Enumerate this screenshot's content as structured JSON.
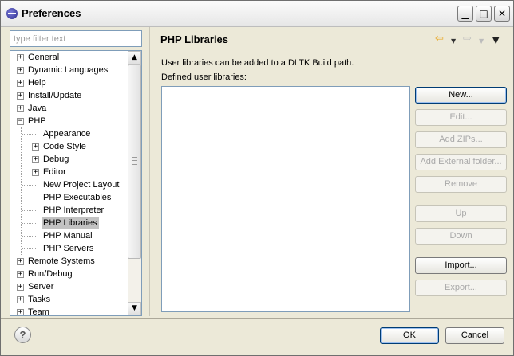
{
  "window": {
    "title": "Preferences"
  },
  "filter": {
    "placeholder": "type filter text"
  },
  "tree": {
    "items": [
      {
        "label": "General",
        "expander": "+"
      },
      {
        "label": "Dynamic Languages",
        "expander": "+"
      },
      {
        "label": "Help",
        "expander": "+"
      },
      {
        "label": "Install/Update",
        "expander": "+"
      },
      {
        "label": "Java",
        "expander": "+"
      },
      {
        "label": "PHP",
        "expander": "−"
      },
      {
        "label": "Appearance"
      },
      {
        "label": "Code Style",
        "expander": "+"
      },
      {
        "label": "Debug",
        "expander": "+"
      },
      {
        "label": "Editor",
        "expander": "+"
      },
      {
        "label": "New Project Layout"
      },
      {
        "label": "PHP Executables"
      },
      {
        "label": "PHP Interpreter"
      },
      {
        "label": "PHP Libraries",
        "selected": true
      },
      {
        "label": "PHP Manual"
      },
      {
        "label": "PHP Servers"
      },
      {
        "label": "Remote Systems",
        "expander": "+"
      },
      {
        "label": "Run/Debug",
        "expander": "+"
      },
      {
        "label": "Server",
        "expander": "+"
      },
      {
        "label": "Tasks",
        "expander": "+"
      },
      {
        "label": "Team",
        "expander": "+"
      }
    ]
  },
  "page": {
    "title": "PHP Libraries",
    "description": "User libraries can be added to a DLTK Build path.",
    "list_label": "Defined user libraries:"
  },
  "buttons": {
    "new": "New...",
    "edit": "Edit...",
    "add_zips": "Add ZIPs...",
    "add_external_folder": "Add External folder...",
    "remove": "Remove",
    "up": "Up",
    "down": "Down",
    "import": "Import...",
    "export": "Export..."
  },
  "footer": {
    "help": "?",
    "ok": "OK",
    "cancel": "Cancel"
  },
  "icons": {
    "minimize": "minimize-icon",
    "maximize": "maximize-icon",
    "close": "close-icon",
    "back": "back-arrow-icon",
    "forward": "forward-arrow-icon",
    "menu": "view-menu-icon"
  },
  "colors": {
    "selection": "#c2c2c2",
    "back_arrow": "#e8a317",
    "disabled_text": "#a9a9a9"
  }
}
